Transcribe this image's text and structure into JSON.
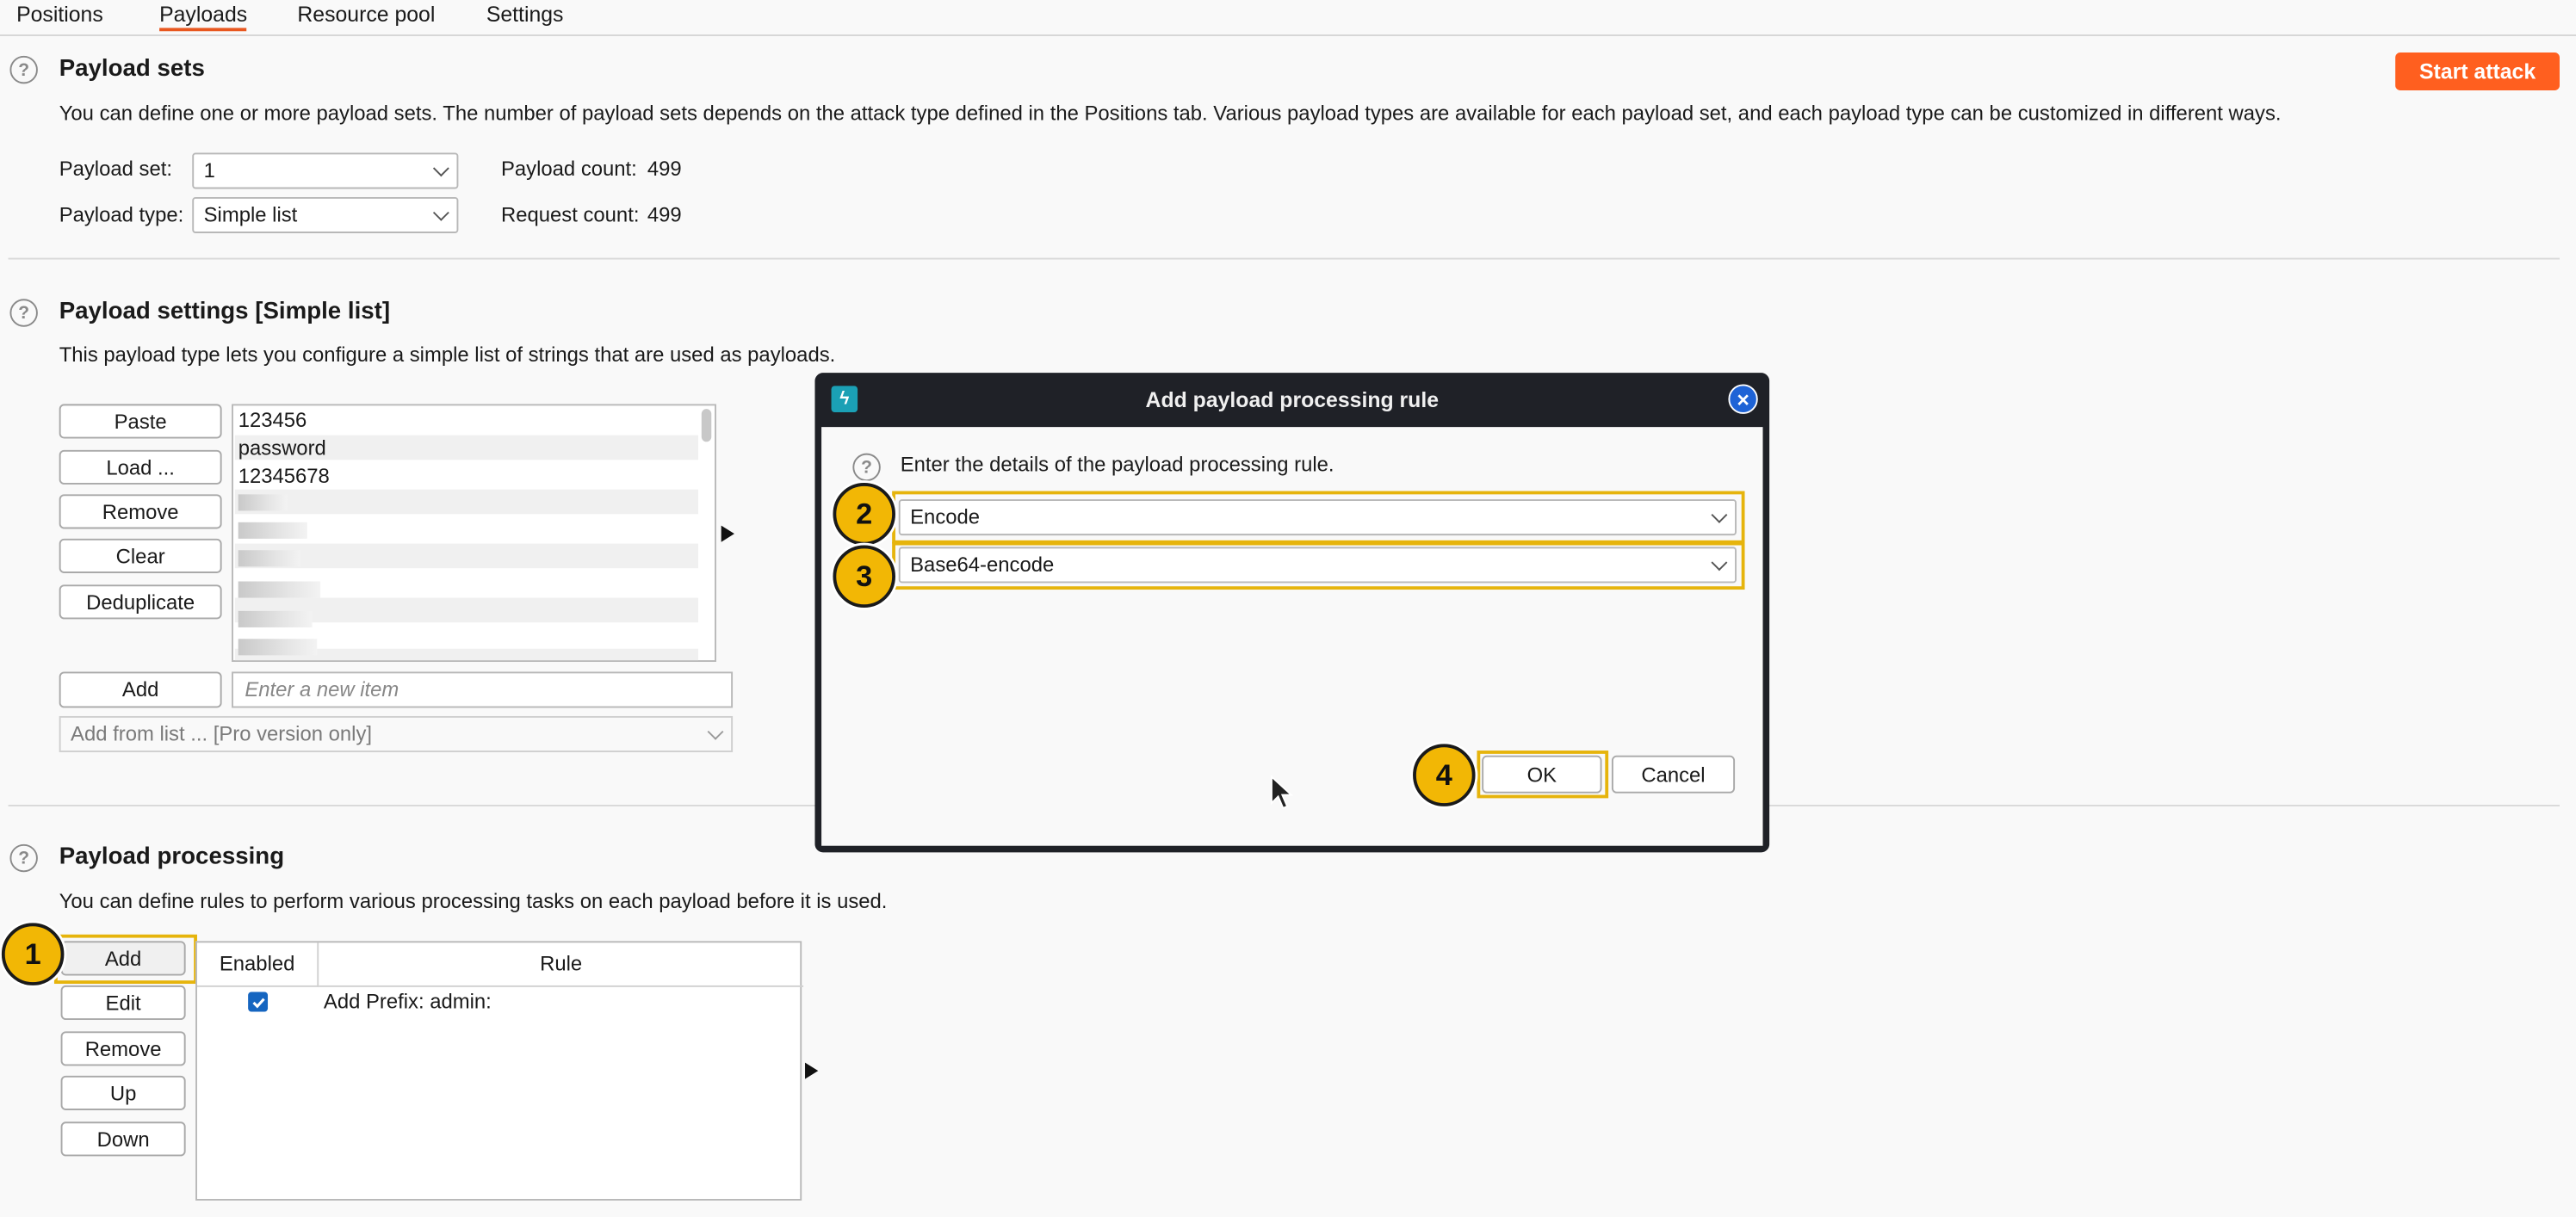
{
  "tabs": [
    "Positions",
    "Payloads",
    "Resource pool",
    "Settings"
  ],
  "active_tab": "Payloads",
  "start_attack": "Start attack",
  "payload_sets": {
    "title": "Payload sets",
    "description": "You can define one or more payload sets. The number of payload sets depends on the attack type defined in the Positions tab. Various payload types are available for each payload set, and each payload type can be customized in different ways.",
    "set_label": "Payload set:",
    "set_value": "1",
    "type_label": "Payload type:",
    "type_value": "Simple list",
    "payload_count_label": "Payload count:",
    "payload_count": "499",
    "request_count_label": "Request count:",
    "request_count": "499"
  },
  "payload_settings": {
    "title": "Payload settings [Simple list]",
    "description": "This payload type lets you configure a simple list of strings that are used as payloads.",
    "buttons": [
      "Paste",
      "Load ...",
      "Remove",
      "Clear",
      "Deduplicate"
    ],
    "items": [
      "123456",
      "password",
      "12345678"
    ],
    "add_label": "Add",
    "new_item_placeholder": "Enter a new item",
    "add_from_list": "Add from list ... [Pro version only]"
  },
  "payload_processing": {
    "title": "Payload processing",
    "description": "You can define rules to perform various processing tasks on each payload before it is used.",
    "buttons": [
      "Add",
      "Edit",
      "Remove",
      "Up",
      "Down"
    ],
    "columns": [
      "Enabled",
      "Rule"
    ],
    "rows": [
      {
        "enabled": true,
        "rule": "Add Prefix: admin:"
      }
    ]
  },
  "dialog": {
    "title": "Add payload processing rule",
    "prompt": "Enter the details of the payload processing rule.",
    "rule_type": "Encode",
    "rule_option": "Base64-encode",
    "ok": "OK",
    "cancel": "Cancel"
  },
  "badges": [
    "1",
    "2",
    "3",
    "4"
  ],
  "colors": {
    "accent": "#e8571f",
    "start_button": "#ff5f1f",
    "highlight": "#e6b40c",
    "badge": "#f2b705",
    "dialog_titlebar": "#1f2127"
  }
}
